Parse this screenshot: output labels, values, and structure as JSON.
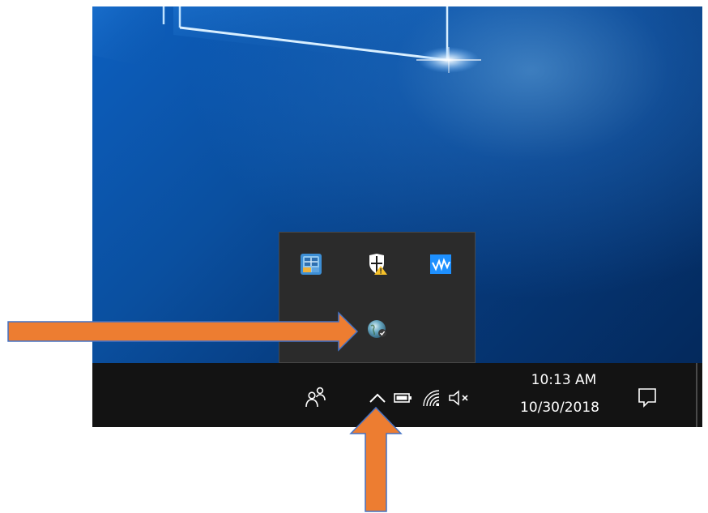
{
  "taskbar": {
    "clock": {
      "time": "10:13 AM",
      "date": "10/30/2018"
    },
    "icons": {
      "people": "people-icon",
      "show_hidden": "chevron-up-icon",
      "battery": "battery-icon",
      "wifi": "wifi-icon",
      "volume": "volume-muted-icon",
      "action_center": "action-center-icon"
    }
  },
  "tray_overflow": {
    "icons": [
      "network-tool-icon",
      "windows-defender-warning-icon",
      "waves-audio-icon",
      "hidden-app-icon",
      "globe-app-icon"
    ]
  },
  "colors": {
    "taskbar": "#131313",
    "overflow_panel": "#2b2b2b",
    "desktop_blue": "#0a4f9f",
    "annotation_arrow": "#ed7d31",
    "arrow_outline": "#4472c4"
  }
}
